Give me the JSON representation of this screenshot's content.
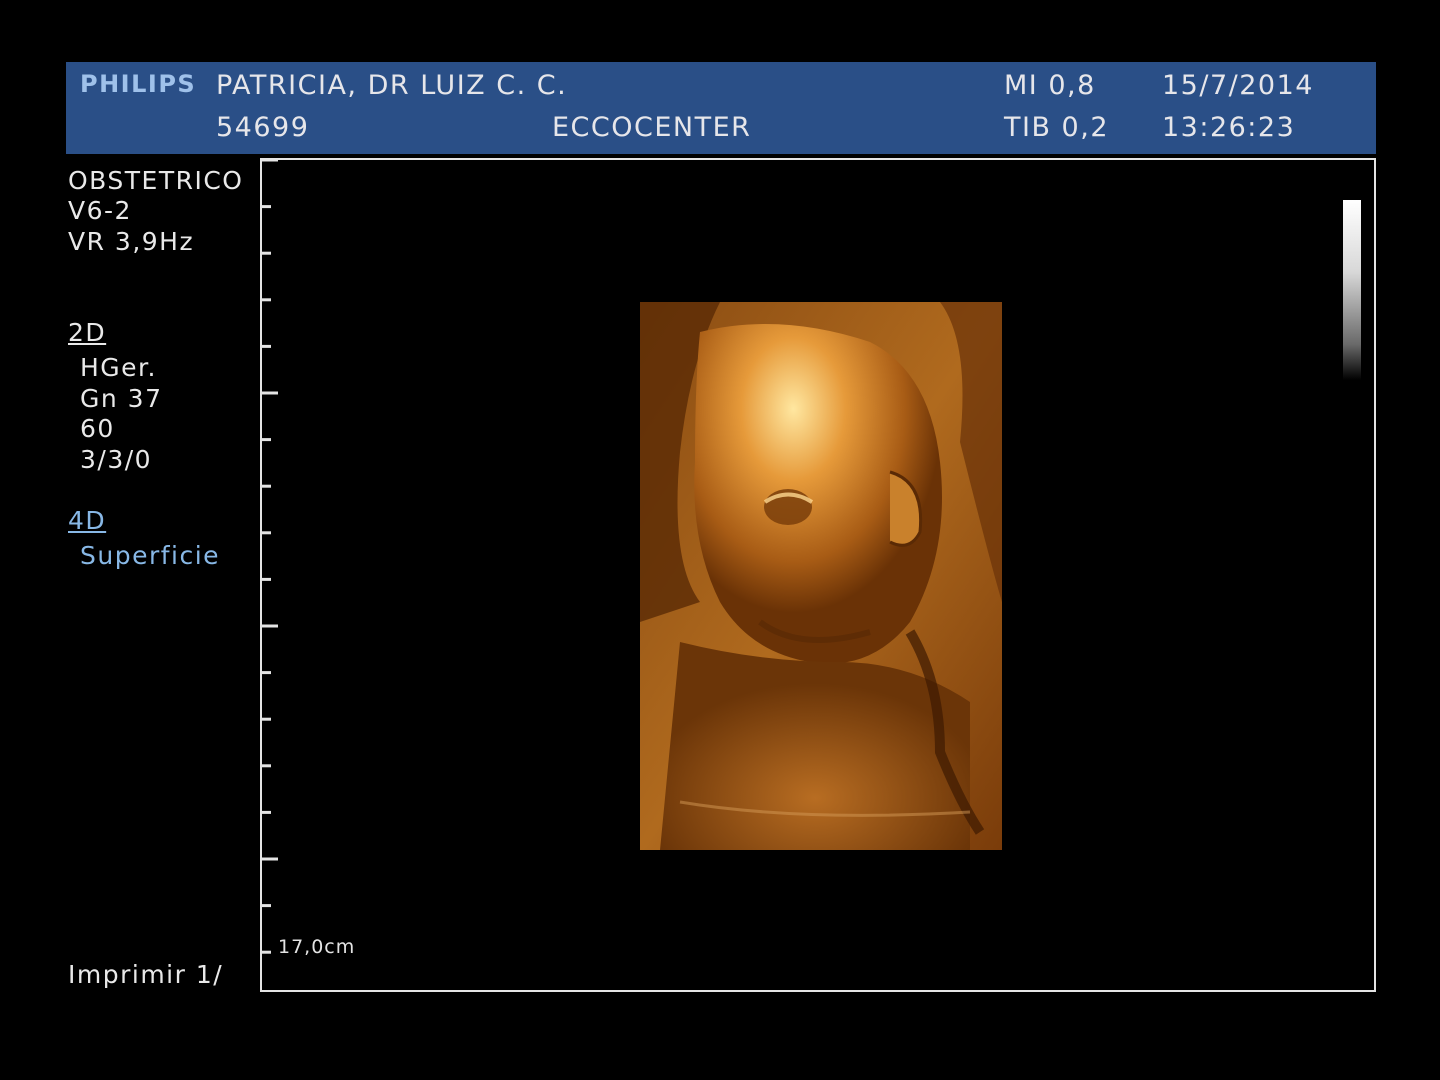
{
  "header": {
    "brand": "PHILIPS",
    "patient": "PATRICIA, DR LUIZ C. C.",
    "patient_id": "54699",
    "institution": "ECCOCENTER",
    "mi": "MI 0,8",
    "tib": "TIB 0,2",
    "date": "15/7/2014",
    "time": "13:26:23"
  },
  "side_panel": {
    "exam": "OBSTETRICO",
    "probe": "V6-2",
    "volume_rate": "VR 3,9Hz",
    "mode_2d": "2D",
    "preset": "HGer.",
    "gain": "Gn 37",
    "dynamic_range": "60",
    "processing": "3/3/0",
    "mode_4d": "4D",
    "render_mode": "Superficie",
    "print": "Imprimir 1/"
  },
  "image": {
    "depth": "17,0cm",
    "render_color": "#c8781e"
  }
}
